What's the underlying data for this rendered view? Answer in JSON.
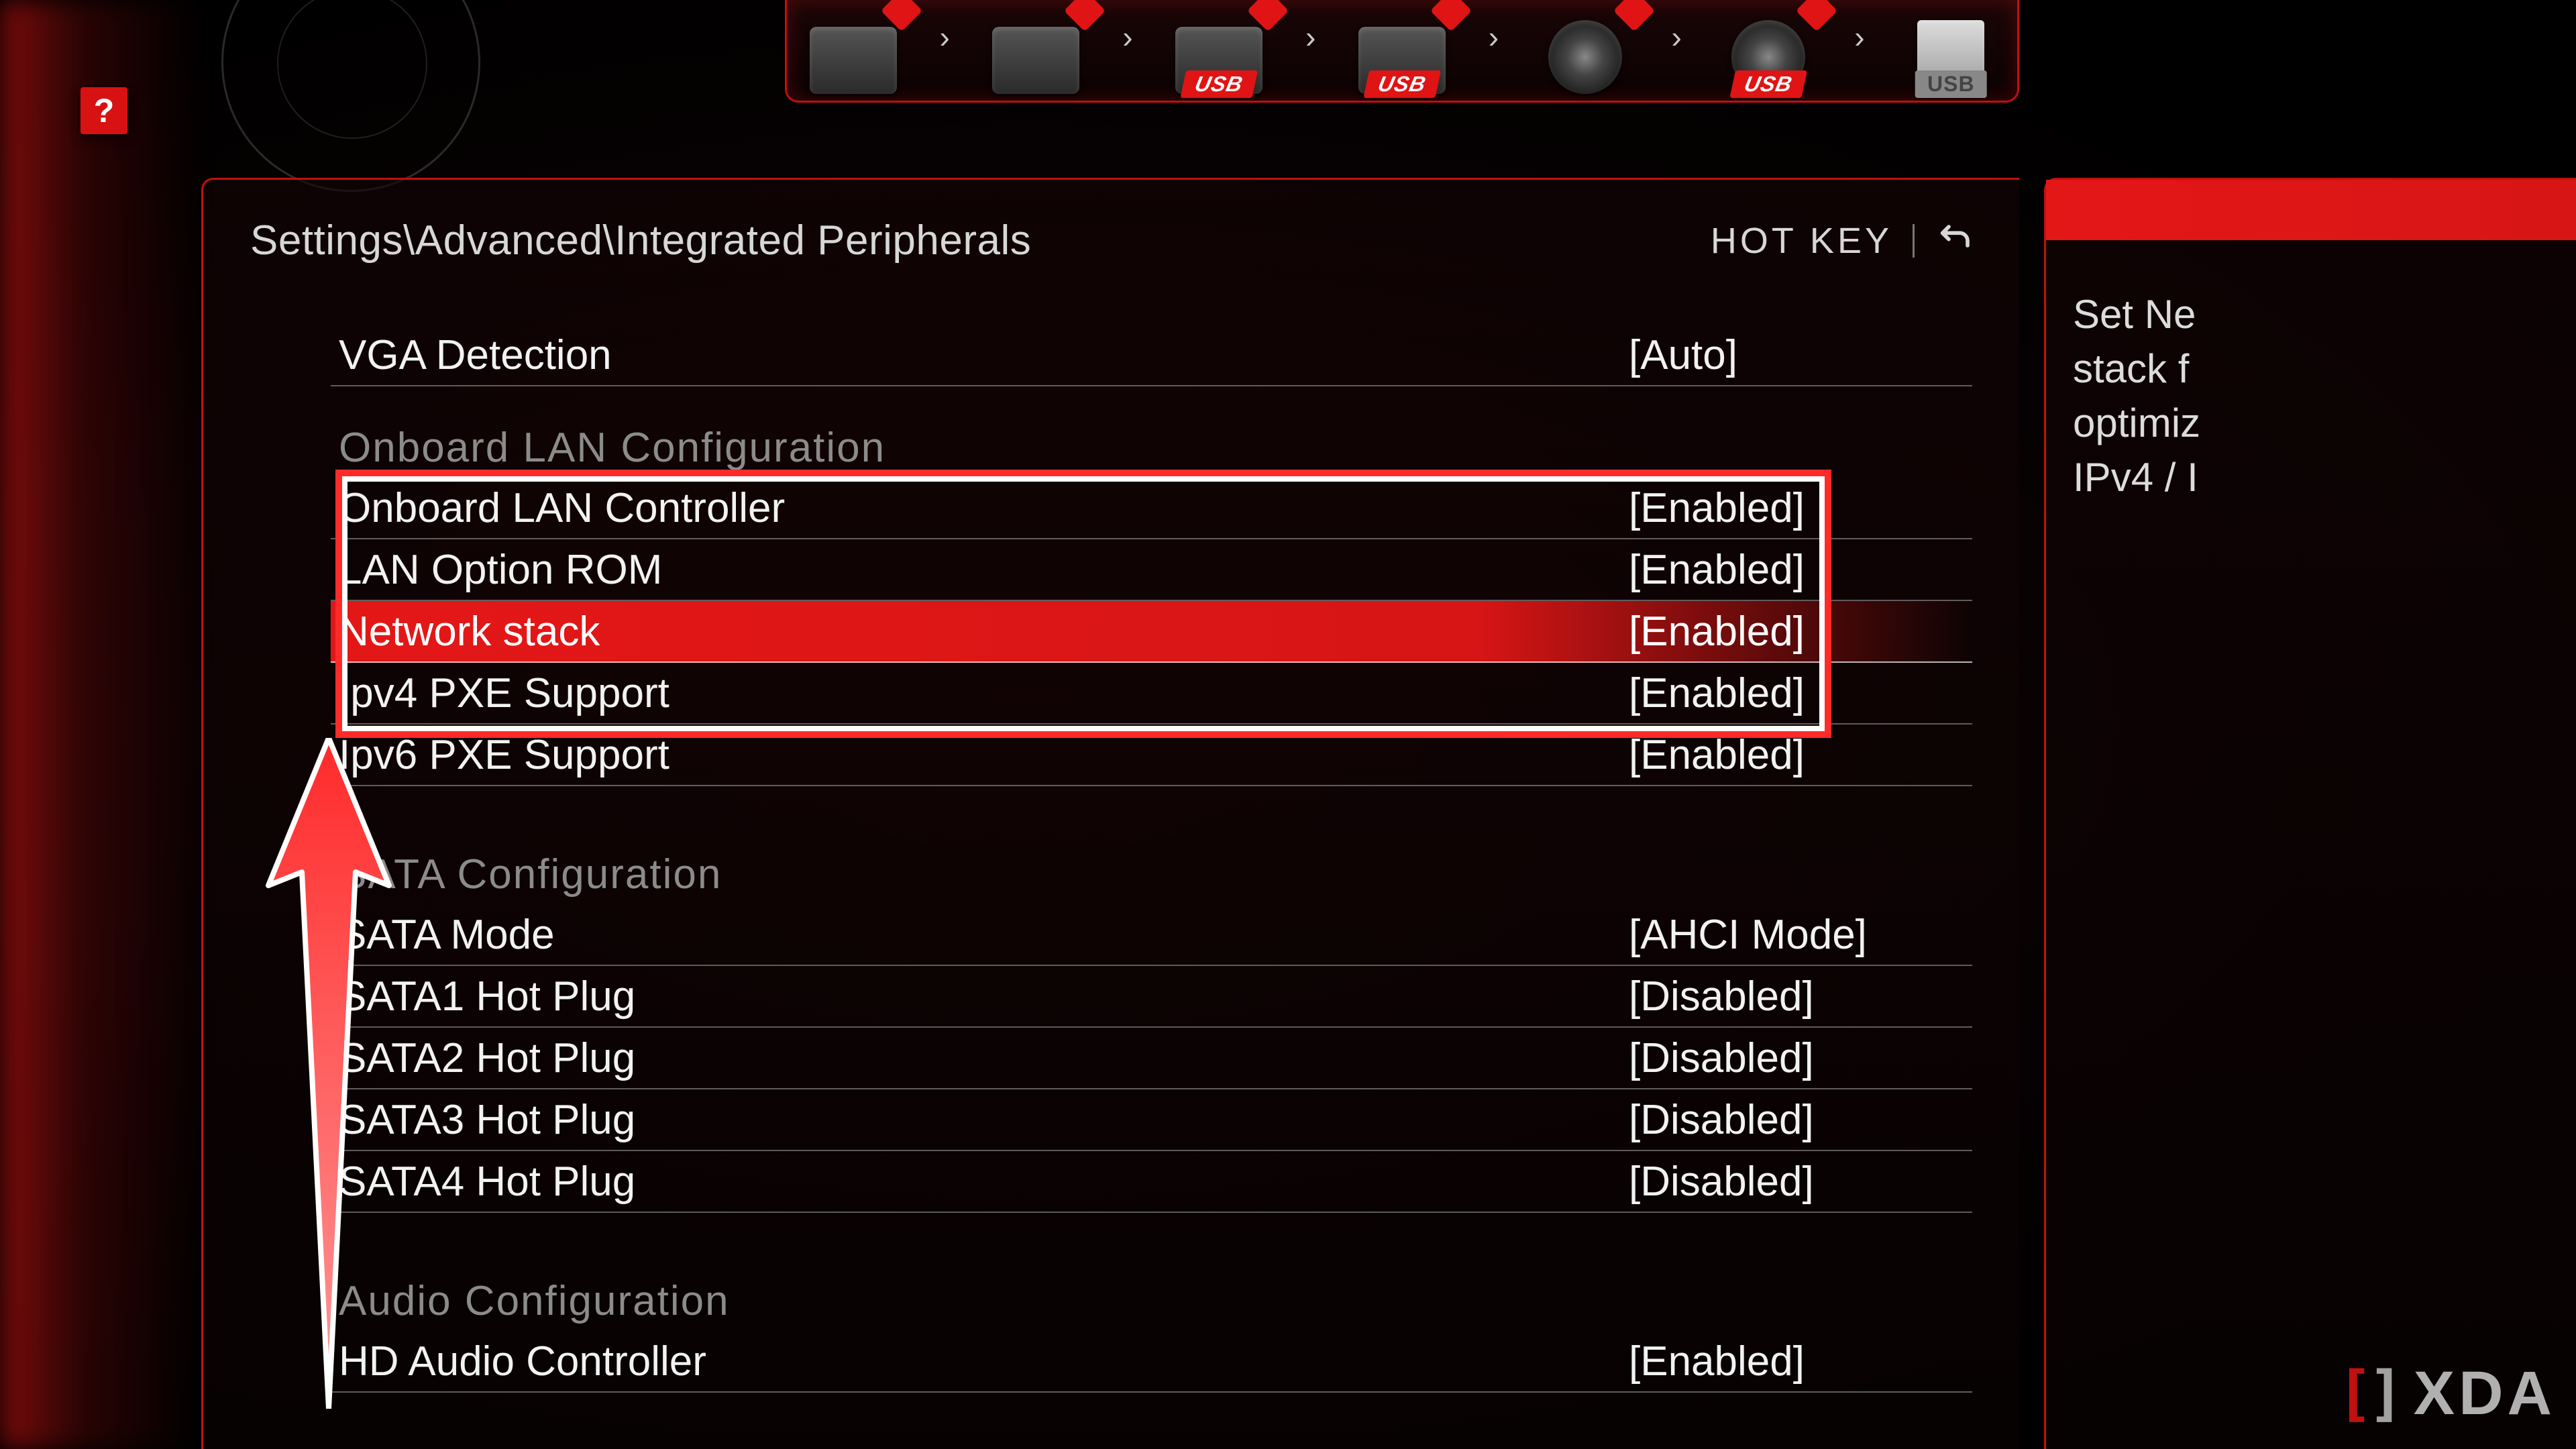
{
  "help_badge": "?",
  "boot": {
    "items": [
      {
        "kind": "lan",
        "usb_tag": null,
        "dot": true
      },
      {
        "kind": "hdd",
        "usb_tag": null,
        "dot": true
      },
      {
        "kind": "hdd",
        "usb_tag": "USB",
        "dot": true
      },
      {
        "kind": "hdd",
        "usb_tag": "USB",
        "dot": true
      },
      {
        "kind": "disc",
        "usb_tag": null,
        "dot": true
      },
      {
        "kind": "disc",
        "usb_tag": "USB",
        "dot": true
      },
      {
        "kind": "usb",
        "usb_tag": "USB",
        "dot": false,
        "gray": true
      }
    ],
    "sep": "›"
  },
  "breadcrumb": "Settings\\Advanced\\Integrated Peripherals",
  "hotkey_label": "HOT KEY",
  "rows": [
    {
      "type": "item",
      "label": "VGA Detection",
      "value": "[Auto]"
    },
    {
      "type": "header",
      "label": "Onboard LAN Configuration"
    },
    {
      "type": "item",
      "label": "Onboard LAN Controller",
      "value": "[Enabled]"
    },
    {
      "type": "item",
      "label": "LAN Option ROM",
      "value": "[Enabled]"
    },
    {
      "type": "item",
      "label": "Network stack",
      "value": "[Enabled]",
      "selected": true
    },
    {
      "type": "item",
      "label": "Ipv4 PXE Support",
      "value": "[Enabled]"
    },
    {
      "type": "item",
      "label": "Ipv6 PXE Support",
      "value": "[Enabled]"
    },
    {
      "type": "spacer"
    },
    {
      "type": "header",
      "label": "SATA  Configuration"
    },
    {
      "type": "item",
      "label": "SATA Mode",
      "value": "[AHCI Mode]"
    },
    {
      "type": "item",
      "label": "SATA1 Hot Plug",
      "value": "[Disabled]"
    },
    {
      "type": "item",
      "label": "SATA2 Hot Plug",
      "value": "[Disabled]"
    },
    {
      "type": "item",
      "label": "SATA3 Hot Plug",
      "value": "[Disabled]"
    },
    {
      "type": "item",
      "label": "SATA4 Hot Plug",
      "value": "[Disabled]"
    },
    {
      "type": "spacer"
    },
    {
      "type": "header",
      "label": "Audio  Configuration"
    },
    {
      "type": "item",
      "label": "HD Audio Controller",
      "value": "[Enabled]"
    }
  ],
  "help_text": "Set Ne\nstack f\noptimiz\nIPv4 / I",
  "watermark": {
    "text": "XDA"
  }
}
